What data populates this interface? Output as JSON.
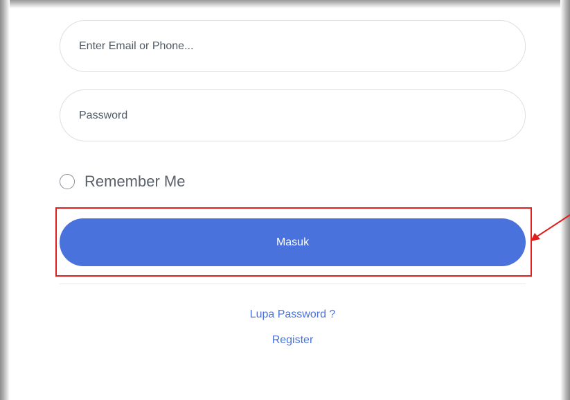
{
  "login_form": {
    "email_placeholder": "Enter Email or Phone...",
    "password_placeholder": "Password",
    "remember_label": "Remember Me",
    "submit_label": "Masuk",
    "forgot_password_label": "Lupa Password ?",
    "register_label": "Register"
  },
  "colors": {
    "primary": "#4a72dd",
    "annotation": "#e11d1d"
  }
}
